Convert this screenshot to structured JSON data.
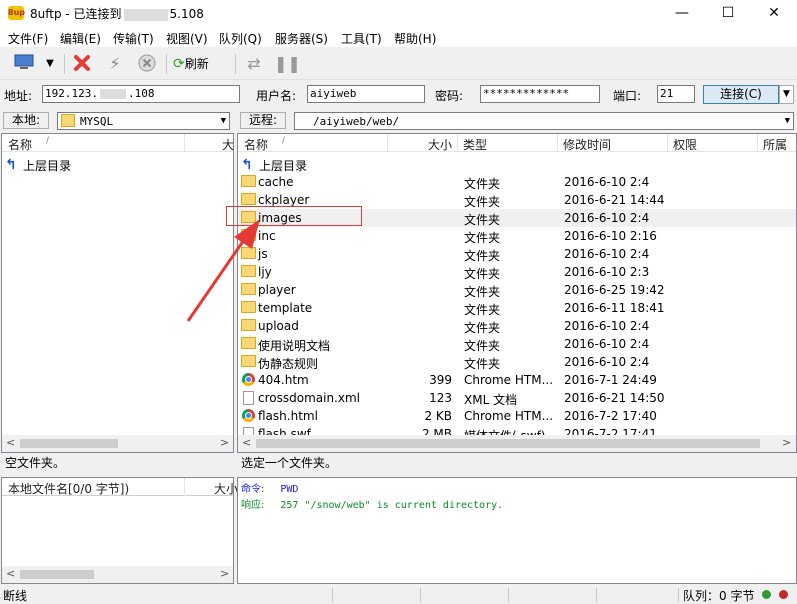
{
  "window": {
    "app_icon_text": "8up",
    "title_prefix": "8uftp - 已连接到",
    "title_suffix": "5.108",
    "minimize": "—",
    "maximize": "☐",
    "close": "✕"
  },
  "menu": [
    "文件(F)",
    "编辑(E)",
    "传输(T)",
    "视图(V)",
    "队列(Q)",
    "服务器(S)",
    "工具(T)",
    "帮助(H)"
  ],
  "toolbar": {
    "refresh_label": "刷新"
  },
  "connection": {
    "address_label": "地址:",
    "address_value": "192.123.",
    "address_suffix": ".108",
    "user_label": "用户名:",
    "user_value": "aiyiweb",
    "password_label": "密码:",
    "password_value": "*************",
    "port_label": "端口:",
    "port_value": "21",
    "connect_button": "连接(C)"
  },
  "local": {
    "label": "本地:",
    "path": "MYSQL",
    "col_name": "名称",
    "col_size": "大",
    "up_dir": "上层目录",
    "status": "空文件夹。",
    "queue_col_name": "本地文件名[0/0 字节])",
    "queue_col_size": "大小"
  },
  "remote": {
    "label": "远程:",
    "path": "/aiyiweb/web/",
    "columns": {
      "name": "名称",
      "size": "大小",
      "type": "类型",
      "mtime": "修改时间",
      "perm": "权限",
      "owner": "所属"
    },
    "up_dir": "上层目录",
    "files": [
      {
        "name": "cache",
        "size": "",
        "type": "文件夹",
        "mtime": "2016-6-10 2:4",
        "icon": "folder-icon"
      },
      {
        "name": "ckplayer",
        "size": "",
        "type": "文件夹",
        "mtime": "2016-6-21 14:44",
        "icon": "folder-icon"
      },
      {
        "name": "images",
        "size": "",
        "type": "文件夹",
        "mtime": "2016-6-10 2:4",
        "icon": "folder-icon"
      },
      {
        "name": "inc",
        "size": "",
        "type": "文件夹",
        "mtime": "2016-6-10 2:16",
        "icon": "folder-icon"
      },
      {
        "name": "js",
        "size": "",
        "type": "文件夹",
        "mtime": "2016-6-10 2:4",
        "icon": "folder-icon"
      },
      {
        "name": "ljy",
        "size": "",
        "type": "文件夹",
        "mtime": "2016-6-10 2:3",
        "icon": "folder-icon"
      },
      {
        "name": "player",
        "size": "",
        "type": "文件夹",
        "mtime": "2016-6-25 19:42",
        "icon": "folder-icon"
      },
      {
        "name": "template",
        "size": "",
        "type": "文件夹",
        "mtime": "2016-6-11 18:41",
        "icon": "folder-icon"
      },
      {
        "name": "upload",
        "size": "",
        "type": "文件夹",
        "mtime": "2016-6-10 2:4",
        "icon": "folder-icon"
      },
      {
        "name": "使用说明文档",
        "size": "",
        "type": "文件夹",
        "mtime": "2016-6-10 2:4",
        "icon": "folder-icon"
      },
      {
        "name": "伪静态规则",
        "size": "",
        "type": "文件夹",
        "mtime": "2016-6-10 2:4",
        "icon": "folder-icon"
      },
      {
        "name": "404.htm",
        "size": "399",
        "type": "Chrome HTM...",
        "mtime": "2016-7-1 24:49",
        "icon": "chrome-icon"
      },
      {
        "name": "crossdomain.xml",
        "size": "123",
        "type": "XML 文档",
        "mtime": "2016-6-21 14:50",
        "icon": "document-icon"
      },
      {
        "name": "flash.html",
        "size": "2 KB",
        "type": "Chrome HTM...",
        "mtime": "2016-7-2 17:40",
        "icon": "chrome-icon"
      },
      {
        "name": "flash.swf",
        "size": "2 MB",
        "type": "媒体文件(.swf)",
        "mtime": "2016-7-2 17:41",
        "icon": "document-icon"
      }
    ],
    "status": "选定一个文件夹。"
  },
  "log": [
    {
      "label": "命令:",
      "text": "PWD",
      "color": "#1a1ad4"
    },
    {
      "label": "响应:",
      "text": "257 \"/snow/web\" is current directory.",
      "color": "#0a8a2a"
    }
  ],
  "statusbar": {
    "left": "断线",
    "queue": "队列：0 字节"
  },
  "colors": {
    "selection_box": "#e53935",
    "annotation_arrow": "#e53935"
  }
}
